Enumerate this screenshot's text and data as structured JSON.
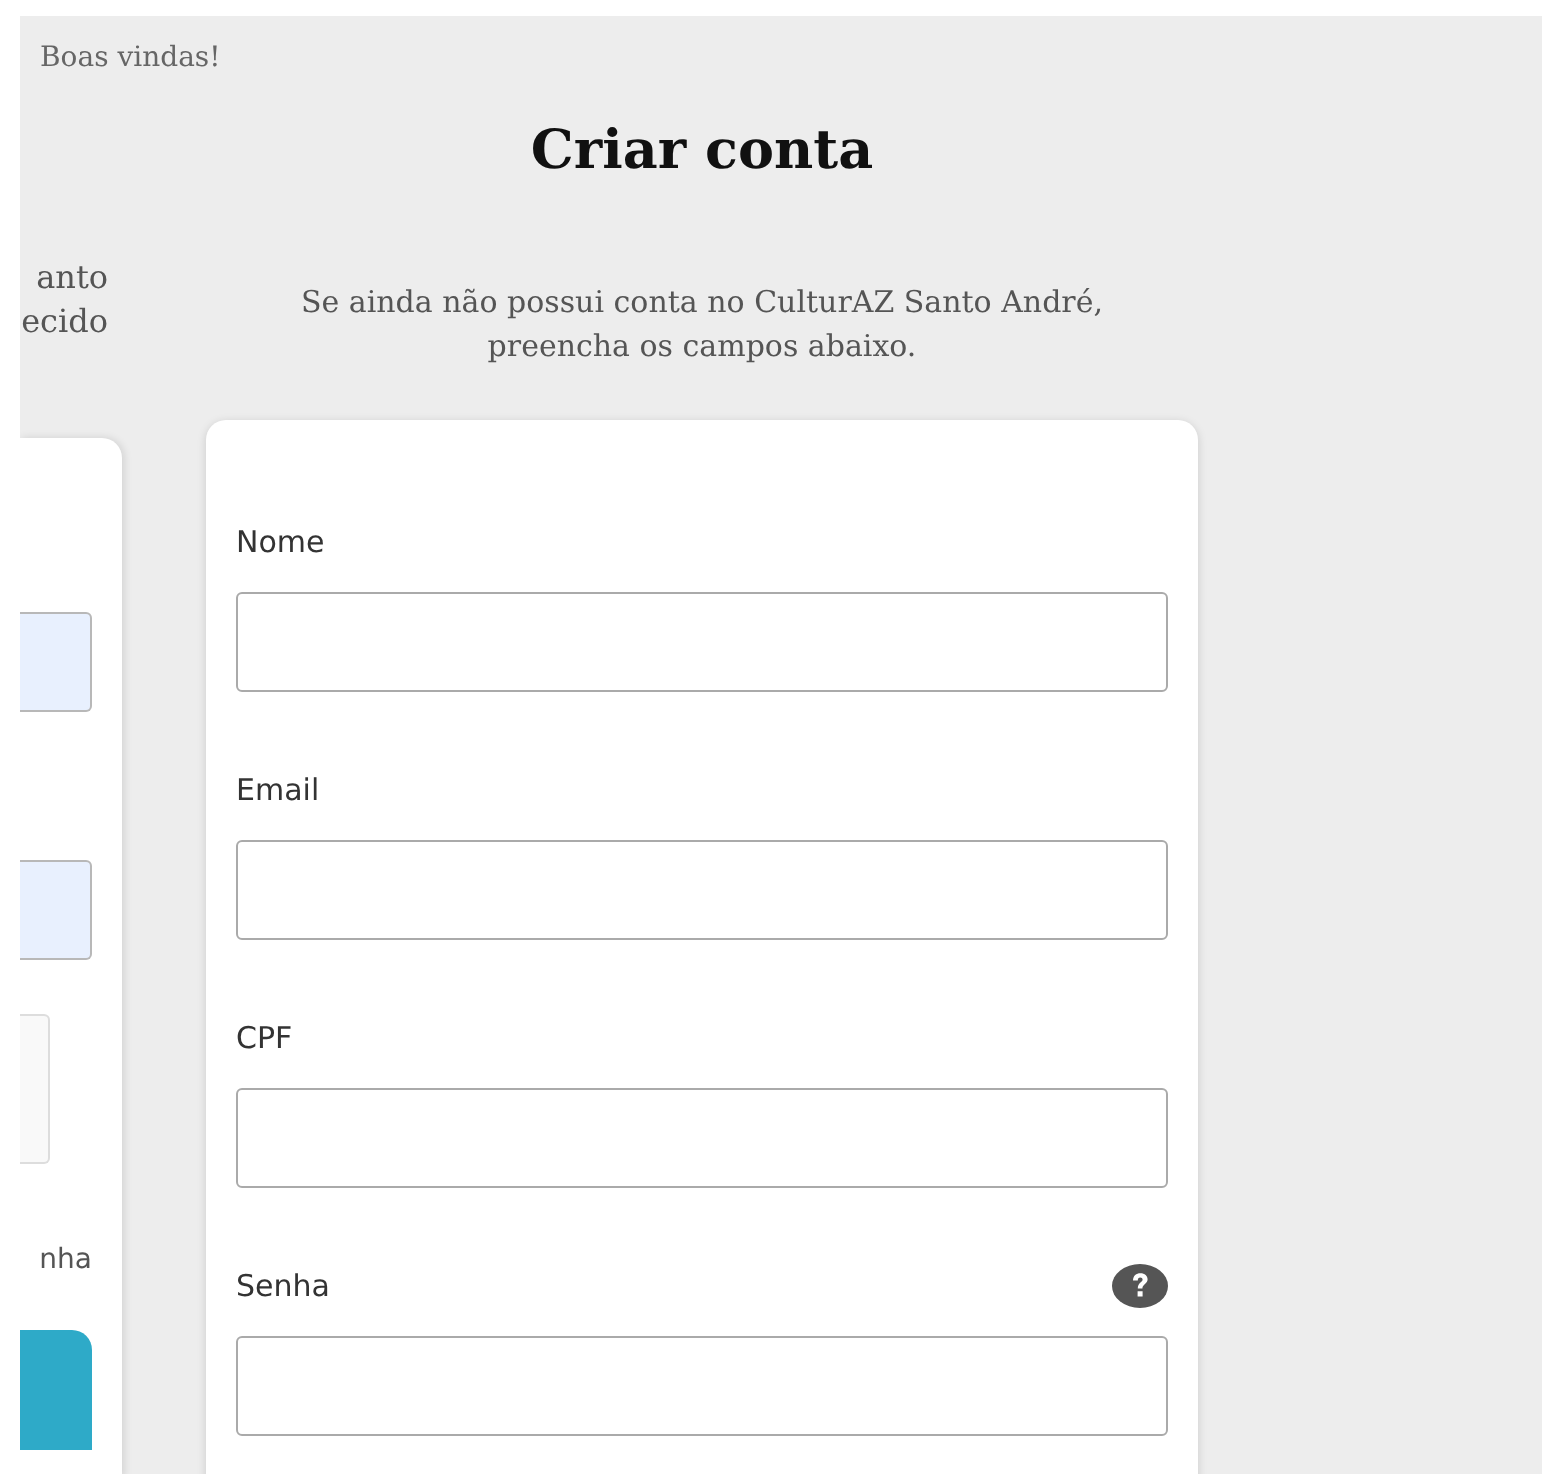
{
  "greeting": "Boas vindas!",
  "left_panel": {
    "intro_lines": [
      "anto",
      "ecido"
    ],
    "fields": [
      {
        "autofilled": true
      },
      {
        "autofilled": true
      }
    ],
    "link_fragment": "nha"
  },
  "signup": {
    "title": "Criar conta",
    "intro": "Se ainda não possui conta no CulturAZ Santo André, preencha os campos abaixo.",
    "fields": [
      {
        "label": "Nome",
        "help": false
      },
      {
        "label": "Email",
        "help": false
      },
      {
        "label": "CPF",
        "help": false
      },
      {
        "label": "Senha",
        "help": true
      }
    ]
  }
}
